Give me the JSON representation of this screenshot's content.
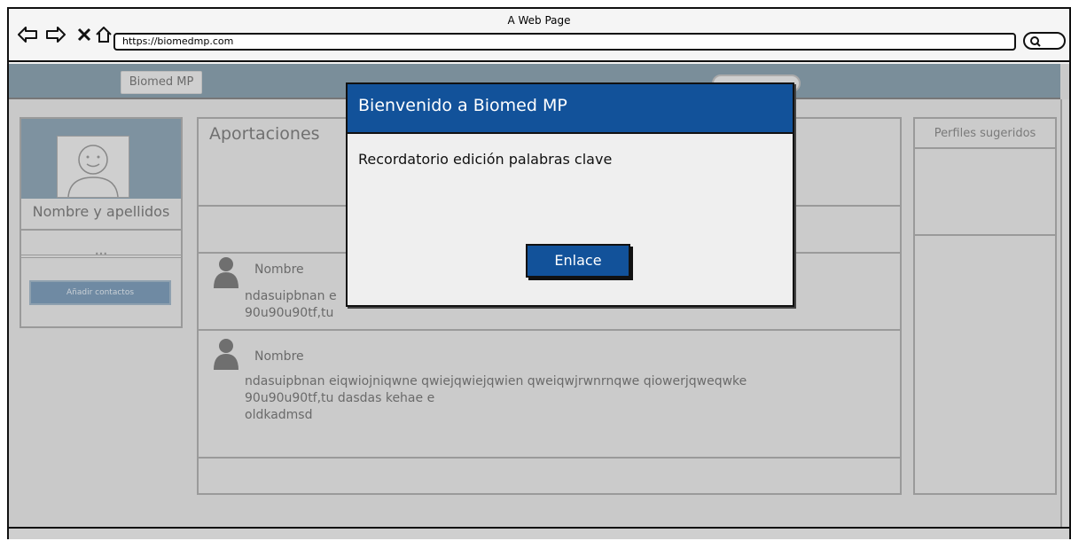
{
  "browser": {
    "window_title": "A Web Page",
    "url": "https://biomedmp.com"
  },
  "app": {
    "brand": "Biomed MP"
  },
  "profile": {
    "name": "Nombre y apellidos",
    "dots": "•••",
    "add_contacts_label": "Añadir contactos"
  },
  "feed": {
    "title": "Aportaciones",
    "posts": [
      {
        "name": "Nombre",
        "lines": [
          "ndasuipbnan e",
          "90u90u90tf,tu"
        ]
      },
      {
        "name": "Nombre",
        "lines": [
          "ndasuipbnan eiqwiojniqwne qwiejqwiejqwien qweiqwjrwnrnqwe qiowerjqweqwke",
          "90u90u90tf,tu dasdas kehae e",
          "oldkadmsd"
        ]
      }
    ]
  },
  "suggested": {
    "title": "Perfiles sugeridos"
  },
  "modal": {
    "title": "Bienvenido a Biomed MP",
    "message": "Recordatorio edición palabras clave",
    "button_label": "Enlace"
  },
  "colors": {
    "modal_header": "#12529a",
    "nav_bar": "#7a8e9a",
    "overlay_grey": "#c9c9c9"
  }
}
